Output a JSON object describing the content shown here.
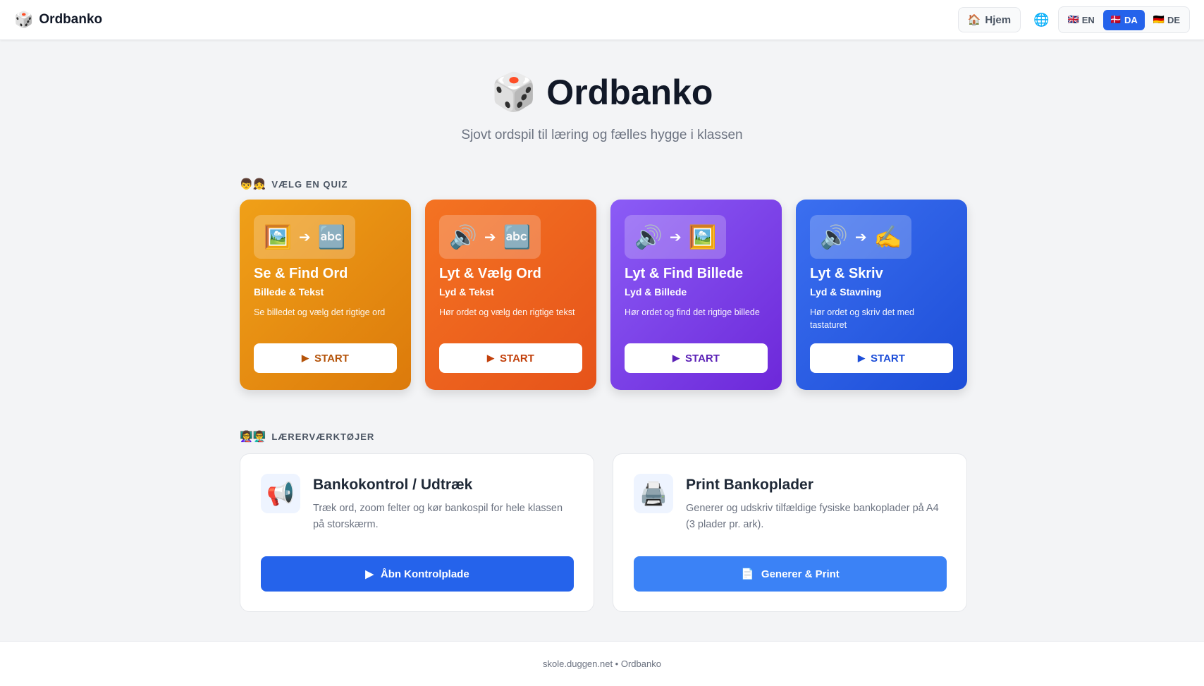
{
  "header": {
    "logo_icon": "🎲",
    "title": "Ordbanko",
    "home": {
      "icon": "🏠",
      "label": "Hjem"
    },
    "globe_icon": "🌐",
    "languages": [
      {
        "flag": "🇬🇧",
        "code": "EN",
        "active": false
      },
      {
        "flag": "🇩🇰",
        "code": "DA",
        "active": true
      },
      {
        "flag": "🇩🇪",
        "code": "DE",
        "active": false
      }
    ]
  },
  "hero": {
    "icon": "🎲",
    "title": "Ordbanko",
    "subtitle": "Sjovt ordspil til læring og fælles hygge i klassen"
  },
  "quiz_section": {
    "icon": "👦👧",
    "label": "VÆLG EN QUIZ",
    "cards": [
      {
        "from_icon": "🖼️",
        "arrow": "➔",
        "to_icon": "🔤",
        "title": "Se & Find Ord",
        "subtitle": "Billede & Tekst",
        "description": "Se billedet og vælg det rigtige ord",
        "button": "START",
        "color": "#e8900f"
      },
      {
        "from_icon": "🔊",
        "arrow": "➔",
        "to_icon": "🔤",
        "title": "Lyt & Vælg Ord",
        "subtitle": "Lyd & Tekst",
        "description": "Hør ordet og vælg den rigtige tekst",
        "button": "START",
        "color": "#ee6420"
      },
      {
        "from_icon": "🔊",
        "arrow": "➔",
        "to_icon": "🖼️",
        "title": "Lyt & Find Billede",
        "subtitle": "Lyd & Billede",
        "description": "Hør ordet og find det rigtige billede",
        "button": "START",
        "color": "#7c3aed"
      },
      {
        "from_icon": "🔊",
        "arrow": "➔",
        "to_icon": "✍️",
        "title": "Lyt & Skriv",
        "subtitle": "Lyd & Stavning",
        "description": "Hør ordet og skriv det med tastaturet",
        "button": "START",
        "color": "#2d5fe6"
      }
    ]
  },
  "tools_section": {
    "icon": "👩‍🏫👨‍🏫",
    "label": "LÆRERVÆRKTØJER",
    "cards": [
      {
        "icon": "📢",
        "title": "Bankokontrol / Udtræk",
        "description": "Træk ord, zoom felter og kør bankospil for hele klassen på storskærm.",
        "button_icon": "▶",
        "button": "Åbn Kontrolplade"
      },
      {
        "icon": "🖨️",
        "title": "Print Bankoplader",
        "description": "Generer og udskriv tilfældige fysiske bankoplader på A4 (3 plader pr. ark).",
        "button_icon": "📄",
        "button": "Generer & Print"
      }
    ]
  },
  "footer": {
    "text": "skole.duggen.net • Ordbanko"
  }
}
